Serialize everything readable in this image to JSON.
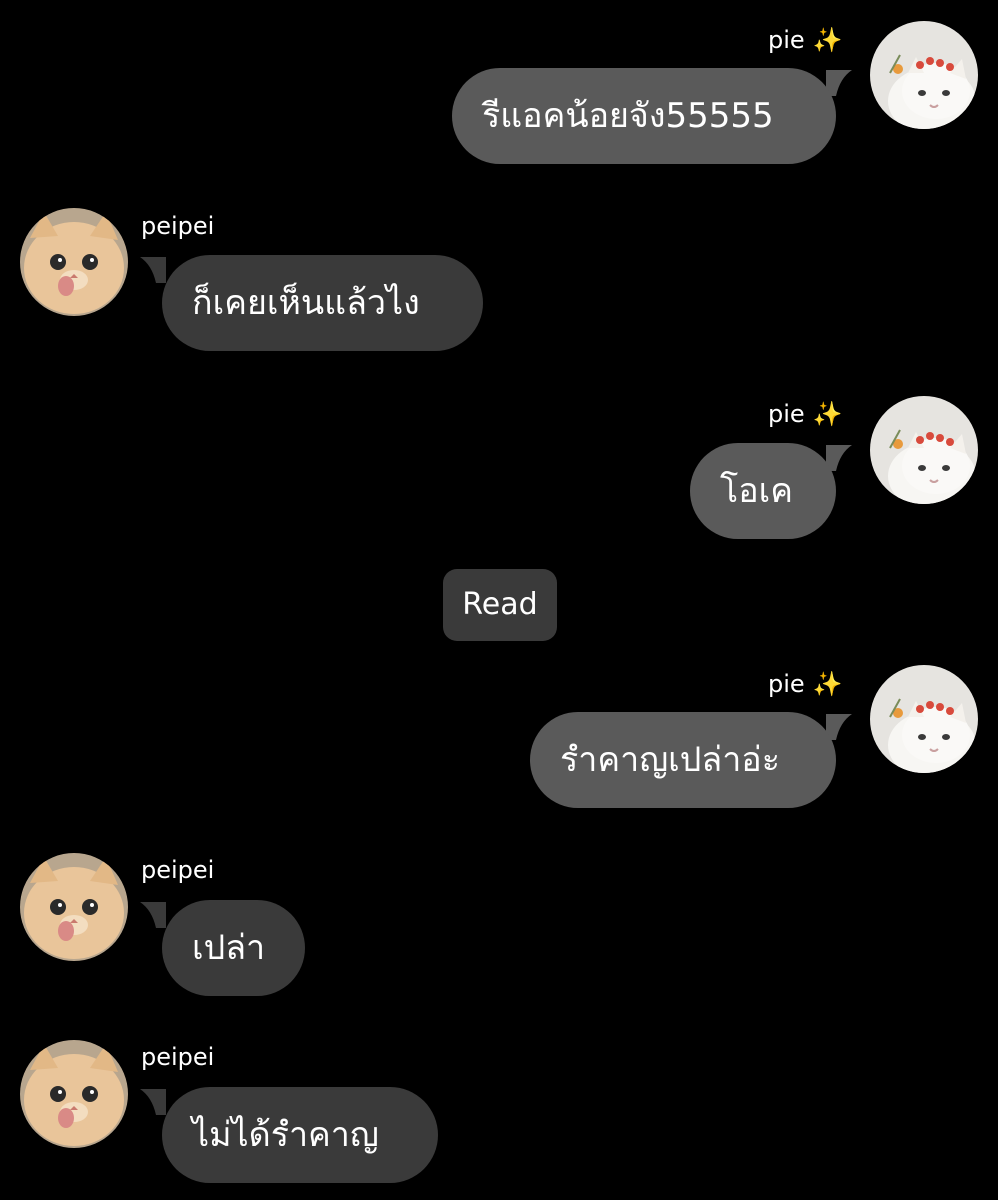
{
  "messages": [
    {
      "sender": "pie",
      "sparkle": "✨",
      "text": "รีแอคน้อยจัง55555"
    },
    {
      "sender": "peipei",
      "text": "ก็เคยเห็นแล้วไง"
    },
    {
      "sender": "pie",
      "sparkle": "✨",
      "text": "โอเค"
    },
    {
      "sender": "pie",
      "sparkle": "✨",
      "text": "รำคาญเปล่าอ่ะ"
    },
    {
      "sender": "peipei",
      "text": "เปล่า"
    },
    {
      "sender": "peipei",
      "text": "ไม่ได้รำคาญ"
    }
  ],
  "read_receipt": "Read",
  "colors": {
    "background": "#000000",
    "my_bubble": "#5a5a5a",
    "their_bubble": "#3a3a3a",
    "sparkle": "#f6c945"
  },
  "avatars": {
    "me": "white-cat-with-flower-crown-avatar",
    "them": "orange-cat-licking-avatar"
  }
}
